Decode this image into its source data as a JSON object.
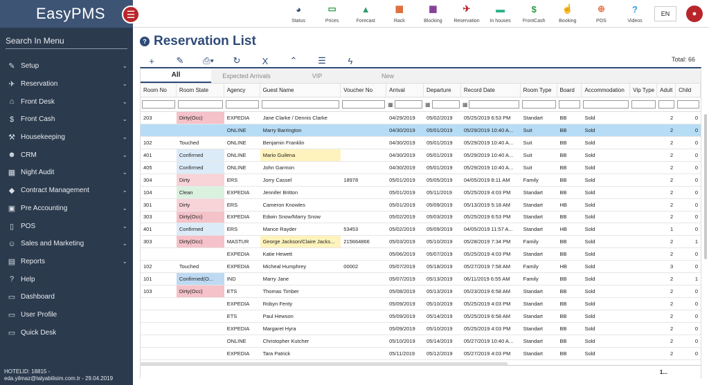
{
  "app": {
    "logo": "EasyPMS"
  },
  "sidebar": {
    "search_label": "Search In Menu",
    "items": [
      {
        "label": "Setup",
        "icon": "wrench-icon",
        "glyph": "✎",
        "chevron": true
      },
      {
        "label": "Reservation",
        "icon": "plane-icon",
        "glyph": "✈",
        "chevron": true
      },
      {
        "label": "Front Desk",
        "icon": "home-icon",
        "glyph": "⌂",
        "chevron": true
      },
      {
        "label": "Front Cash",
        "icon": "dollar-icon",
        "glyph": "$",
        "chevron": true
      },
      {
        "label": "Housekeeping",
        "icon": "broom-icon",
        "glyph": "⚒",
        "chevron": true
      },
      {
        "label": "CRM",
        "icon": "globe-icon",
        "glyph": "☻",
        "chevron": true
      },
      {
        "label": "Night Audit",
        "icon": "calendar-icon",
        "glyph": "▦",
        "chevron": true
      },
      {
        "label": "Contract Management",
        "icon": "tag-icon",
        "glyph": "◆",
        "chevron": true
      },
      {
        "label": "Pre Accounting",
        "icon": "id-card-icon",
        "glyph": "▣",
        "chevron": true
      },
      {
        "label": "POS",
        "icon": "mobile-icon",
        "glyph": "▯",
        "chevron": true
      },
      {
        "label": "Sales and Marketing",
        "icon": "users-icon",
        "glyph": "☺",
        "chevron": true
      },
      {
        "label": "Reports",
        "icon": "file-icon",
        "glyph": "▤",
        "chevron": true
      },
      {
        "label": "Help",
        "icon": "question-icon",
        "glyph": "?",
        "chevron": false
      },
      {
        "label": "Dashboard",
        "icon": "dashboard-icon",
        "glyph": "▭",
        "chevron": false
      },
      {
        "label": "User Profile",
        "icon": "user-profile-icon",
        "glyph": "▭",
        "chevron": false
      },
      {
        "label": "Quick Desk",
        "icon": "monitor-icon",
        "glyph": "▭",
        "chevron": false
      }
    ],
    "footer_line1": "HOTELID: 18815 -",
    "footer_line2": "eda.yilmaz@talyabilisim.com.tr - 29.04.2019"
  },
  "topbar": {
    "items": [
      {
        "label": "Status",
        "icon": "pie-chart-icon",
        "glyph": "◕",
        "color": "#2e4a78"
      },
      {
        "label": "Prices",
        "icon": "price-icon",
        "glyph": "▭",
        "color": "#2e9b45"
      },
      {
        "label": "Forecast",
        "icon": "forecast-icon",
        "glyph": "▲",
        "color": "#2e9b6b"
      },
      {
        "label": "Rack",
        "icon": "rack-icon",
        "glyph": "▦",
        "color": "#d9622b"
      },
      {
        "label": "Blocking",
        "icon": "calendar-icon",
        "glyph": "▦",
        "color": "#7a2e8e"
      },
      {
        "label": "Reservation",
        "icon": "plane-icon",
        "glyph": "✈",
        "color": "#b8262b"
      },
      {
        "label": "In houses",
        "icon": "bed-icon",
        "glyph": "▬",
        "color": "#2eb08a"
      },
      {
        "label": "FrontCash",
        "icon": "dollar-icon",
        "glyph": "$",
        "color": "#2e9b45"
      },
      {
        "label": "Booking",
        "icon": "hand-icon",
        "glyph": "☝",
        "color": "#e5734a"
      },
      {
        "label": "POS",
        "icon": "cart-icon",
        "glyph": "⊕",
        "color": "#e5734a"
      },
      {
        "label": "Videos",
        "icon": "question-icon",
        "glyph": "?",
        "color": "#2e9be0"
      }
    ],
    "lang": "EN"
  },
  "page": {
    "title": "Reservation List",
    "total": "Total: 66",
    "pager": "1..."
  },
  "toolbar": [
    {
      "name": "add-icon",
      "glyph": "+"
    },
    {
      "name": "edit-icon",
      "glyph": "✎"
    },
    {
      "name": "print-icon",
      "glyph": "⎙▾"
    },
    {
      "name": "refresh-icon",
      "glyph": "↻"
    },
    {
      "name": "excel-icon",
      "glyph": "X"
    },
    {
      "name": "chevron-up-icon",
      "glyph": "⌃"
    },
    {
      "name": "menu-icon",
      "glyph": "☰"
    },
    {
      "name": "bolt-icon",
      "glyph": "ϟ"
    }
  ],
  "tabs": [
    "All",
    "Expected Arrivals",
    "VIP",
    "New"
  ],
  "columns": [
    {
      "key": "room",
      "label": "Room No",
      "w": 52
    },
    {
      "key": "state",
      "label": "Room State",
      "w": 69
    },
    {
      "key": "agency",
      "label": "Agency",
      "w": 52
    },
    {
      "key": "guest",
      "label": "Guest Name",
      "w": 117
    },
    {
      "key": "voucher",
      "label": "Voucher No",
      "w": 66
    },
    {
      "key": "arrival",
      "label": "Arrival",
      "w": 54,
      "cal": true
    },
    {
      "key": "departure",
      "label": "Departure",
      "w": 54,
      "cal": true
    },
    {
      "key": "record",
      "label": "Record Date",
      "w": 86,
      "cal": true
    },
    {
      "key": "roomtype",
      "label": "Room Type",
      "w": 53
    },
    {
      "key": "board",
      "label": "Board",
      "w": 36
    },
    {
      "key": "accommodation",
      "label": "Accommodation",
      "w": 70
    },
    {
      "key": "vip",
      "label": "Vip Type",
      "w": 39
    },
    {
      "key": "adult",
      "label": "Adult",
      "w": 27,
      "num": true
    },
    {
      "key": "child",
      "label": "Child",
      "w": 36,
      "num": true
    }
  ],
  "rows": [
    {
      "room": "203",
      "state": "Dirty(Occ)",
      "st": "dirtyocc",
      "agency": "EXPEDIA",
      "guest": "Jane Clarke / Dennis Clarke",
      "voucher": "",
      "arrival": "04/29/2019",
      "departure": "05/02/2019",
      "record": "05/25/2019 6:53 PM",
      "roomtype": "Standart",
      "board": "BB",
      "accommodation": "Sold",
      "vip": "",
      "adult": "2",
      "child": "0"
    },
    {
      "room": "",
      "state": "",
      "st": "",
      "agency": "ONLINE",
      "guest": "Marry Barrington",
      "voucher": "",
      "arrival": "04/30/2019",
      "departure": "05/01/2019",
      "record": "05/29/2019 10:40 A...",
      "roomtype": "Suit",
      "board": "BB",
      "accommodation": "Sold",
      "vip": "",
      "adult": "2",
      "child": "0",
      "sel": true
    },
    {
      "room": "102",
      "state": "Touched",
      "st": "",
      "agency": "ONLINE",
      "guest": "Benjamin Franklin",
      "voucher": "",
      "arrival": "04/30/2019",
      "departure": "05/01/2019",
      "record": "05/29/2019 10:40 A...",
      "roomtype": "Suit",
      "board": "BB",
      "accommodation": "Sold",
      "vip": "",
      "adult": "2",
      "child": "0"
    },
    {
      "room": "401",
      "state": "Confirmed",
      "st": "confirmed",
      "agency": "ONLINE",
      "guest": "Mario Guilena",
      "voucher": "",
      "arrival": "04/30/2019",
      "departure": "05/01/2019",
      "record": "05/29/2019 10:40 A...",
      "roomtype": "Suit",
      "board": "BB",
      "accommodation": "Sold",
      "vip": "",
      "adult": "2",
      "child": "0",
      "hl": true
    },
    {
      "room": "405",
      "state": "Confirmed",
      "st": "confirmed",
      "agency": "ONLINE",
      "guest": "John Garmon",
      "voucher": "",
      "arrival": "04/30/2019",
      "departure": "05/01/2019",
      "record": "05/29/2019 10:40 A...",
      "roomtype": "Suit",
      "board": "BB",
      "accommodation": "Sold",
      "vip": "",
      "adult": "2",
      "child": "0"
    },
    {
      "room": "304",
      "state": "Dirty",
      "st": "dirty",
      "agency": "ERS",
      "guest": "Jorry Cassel",
      "voucher": "18978",
      "arrival": "05/01/2019",
      "departure": "05/05/2019",
      "record": "04/05/2019 8:11 AM",
      "roomtype": "Family",
      "board": "BB",
      "accommodation": "Sold",
      "vip": "",
      "adult": "2",
      "child": "0"
    },
    {
      "room": "104",
      "state": "Clean",
      "st": "clean",
      "agency": "EXPEDIA",
      "guest": "Jennifer Britton",
      "voucher": "",
      "arrival": "05/01/2019",
      "departure": "05/11/2019",
      "record": "05/25/2019 4:03 PM",
      "roomtype": "Standart",
      "board": "BB",
      "accommodation": "Sold",
      "vip": "",
      "adult": "2",
      "child": "0"
    },
    {
      "room": "301",
      "state": "Dirty",
      "st": "dirty",
      "agency": "ERS",
      "guest": "Cameron Knowles",
      "voucher": "",
      "arrival": "05/01/2019",
      "departure": "05/09/2019",
      "record": "05/13/2019 5:18 AM",
      "roomtype": "Standart",
      "board": "HB",
      "accommodation": "Sold",
      "vip": "",
      "adult": "2",
      "child": "0"
    },
    {
      "room": "303",
      "state": "Dirty(Occ)",
      "st": "dirtyocc",
      "agency": "EXPEDIA",
      "guest": "Edwin Snow/Marry Snow",
      "voucher": "",
      "arrival": "05/02/2019",
      "departure": "05/03/2019",
      "record": "05/25/2019 6:53 PM",
      "roomtype": "Standart",
      "board": "BB",
      "accommodation": "Sold",
      "vip": "",
      "adult": "2",
      "child": "0"
    },
    {
      "room": "401",
      "state": "Confirmed",
      "st": "confirmed",
      "agency": "ERS",
      "guest": "Mance Rayder",
      "voucher": "53453",
      "arrival": "05/02/2019",
      "departure": "05/09/2019",
      "record": "04/05/2019 11:57 A...",
      "roomtype": "Standart",
      "board": "HB",
      "accommodation": "Sold",
      "vip": "",
      "adult": "1",
      "child": "0"
    },
    {
      "room": "303",
      "state": "Dirty(Occ)",
      "st": "dirtyocc",
      "agency": "MASTUR",
      "guest": "George Jackson/Claire Jacks...",
      "voucher": "215664866",
      "arrival": "05/03/2019",
      "departure": "05/10/2019",
      "record": "05/28/2019 7:34 PM",
      "roomtype": "Family",
      "board": "BB",
      "accommodation": "Sold",
      "vip": "",
      "adult": "2",
      "child": "1",
      "hl": true
    },
    {
      "room": "",
      "state": "",
      "st": "",
      "agency": "EXPEDIA",
      "guest": "Katie Hewett",
      "voucher": "",
      "arrival": "05/06/2019",
      "departure": "05/07/2019",
      "record": "05/25/2019 4:03 PM",
      "roomtype": "Standart",
      "board": "BB",
      "accommodation": "Sold",
      "vip": "",
      "adult": "2",
      "child": "0"
    },
    {
      "room": "102",
      "state": "Touched",
      "st": "",
      "agency": "EXPEDIA",
      "guest": "Micheal Humphrey",
      "voucher": "00002",
      "arrival": "05/07/2019",
      "departure": "05/18/2019",
      "record": "05/27/2019 7:58 AM",
      "roomtype": "Family",
      "board": "HB",
      "accommodation": "Sold",
      "vip": "",
      "adult": "3",
      "child": "0"
    },
    {
      "room": "101",
      "state": "Confirmed(O...",
      "st": "confirmedocc",
      "agency": "IND",
      "guest": "Marry Jane",
      "voucher": "",
      "arrival": "05/07/2019",
      "departure": "05/13/2019",
      "record": "06/11/2019 6:55 AM",
      "roomtype": "Family",
      "board": "BB",
      "accommodation": "Sold",
      "vip": "",
      "adult": "2",
      "child": "1"
    },
    {
      "room": "103",
      "state": "Dirty(Occ)",
      "st": "dirtyocc",
      "agency": "ETS",
      "guest": "Thomas Timber",
      "voucher": "",
      "arrival": "05/08/2019",
      "departure": "05/13/2019",
      "record": "05/23/2019 6:58 AM",
      "roomtype": "Standart",
      "board": "BB",
      "accommodation": "Sold",
      "vip": "",
      "adult": "2",
      "child": "0"
    },
    {
      "room": "",
      "state": "",
      "st": "",
      "agency": "EXPEDIA",
      "guest": "Robyn Fenty",
      "voucher": "",
      "arrival": "05/09/2019",
      "departure": "05/10/2019",
      "record": "05/25/2019 4:03 PM",
      "roomtype": "Standart",
      "board": "BB",
      "accommodation": "Sold",
      "vip": "",
      "adult": "2",
      "child": "0"
    },
    {
      "room": "",
      "state": "",
      "st": "",
      "agency": "ETS",
      "guest": "Paul Hewson",
      "voucher": "",
      "arrival": "05/09/2019",
      "departure": "05/14/2019",
      "record": "05/25/2019 6:58 AM",
      "roomtype": "Standart",
      "board": "BB",
      "accommodation": "Sold",
      "vip": "",
      "adult": "2",
      "child": "0"
    },
    {
      "room": "",
      "state": "",
      "st": "",
      "agency": "EXPEDIA",
      "guest": "Margaret Hyra",
      "voucher": "",
      "arrival": "05/09/2019",
      "departure": "05/10/2019",
      "record": "05/25/2019 4:03 PM",
      "roomtype": "Standart",
      "board": "BB",
      "accommodation": "Sold",
      "vip": "",
      "adult": "2",
      "child": "0"
    },
    {
      "room": "",
      "state": "",
      "st": "",
      "agency": "ONLINE",
      "guest": "Christopher Kutcher",
      "voucher": "",
      "arrival": "05/10/2019",
      "departure": "05/14/2019",
      "record": "05/27/2019 10:40 A...",
      "roomtype": "Standart",
      "board": "BB",
      "accommodation": "Sold",
      "vip": "",
      "adult": "2",
      "child": "0"
    },
    {
      "room": "",
      "state": "",
      "st": "",
      "agency": "EXPEDIA",
      "guest": "Tara Patrick",
      "voucher": "",
      "arrival": "05/11/2019",
      "departure": "05/12/2019",
      "record": "05/27/2019 4:03 PM",
      "roomtype": "Standart",
      "board": "BB",
      "accommodation": "Sold",
      "vip": "",
      "adult": "2",
      "child": "0"
    }
  ]
}
